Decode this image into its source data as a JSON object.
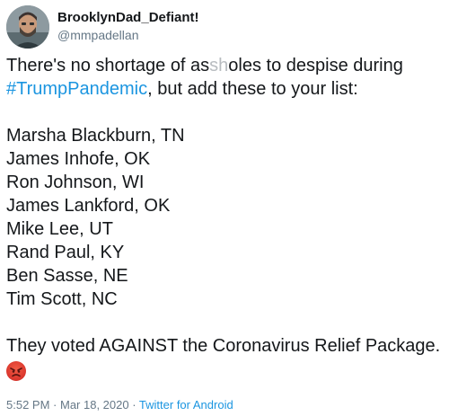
{
  "user": {
    "display_name": "BrooklynDad_Defiant!",
    "handle": "@mmpadellan"
  },
  "tweet": {
    "intro_before": "There's no shortage of as",
    "intro_obscured": "sh",
    "intro_after": "oles to despise during",
    "hashtag": "#TrumpPandemic",
    "intro_line2": ", but add these to your list:",
    "senators": [
      "Marsha Blackburn, TN",
      "James Inhofe, OK",
      "Ron Johnson, WI",
      "James Lankford, OK",
      "Mike Lee, UT",
      "Rand Paul, KY",
      "Ben Sasse, NE",
      "Tim Scott, NC"
    ],
    "closing": "They voted AGAINST the Coronavirus Relief Package.",
    "emoji": "angry-face-emoji"
  },
  "meta": {
    "time": "5:52 PM",
    "separator": " · ",
    "date": "Mar 18, 2020",
    "source": "Twitter for Android"
  },
  "colors": {
    "link": "#1b95e0",
    "text": "#14171a",
    "secondary": "#657786"
  }
}
